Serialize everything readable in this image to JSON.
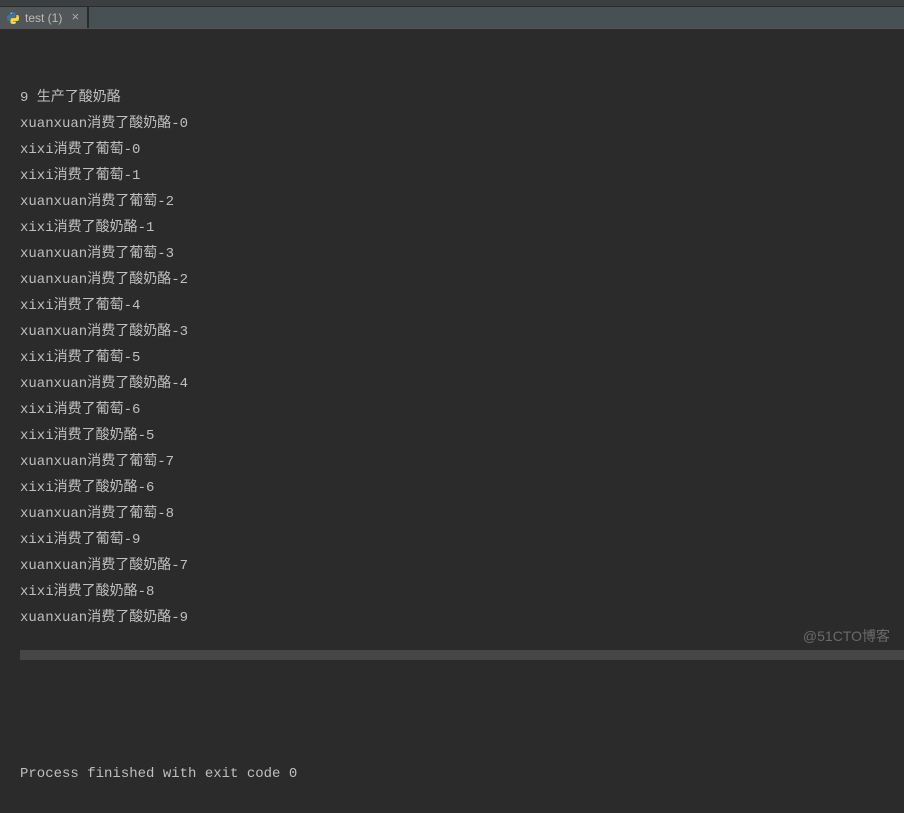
{
  "tab": {
    "label": "test (1)",
    "icon_name": "python-file-icon"
  },
  "console": {
    "lines": [
      "9 生产了酸奶酪",
      "xuanxuan消费了酸奶酪-0",
      "xixi消费了葡萄-0",
      "xixi消费了葡萄-1",
      "xuanxuan消费了葡萄-2",
      "xixi消费了酸奶酪-1",
      "xuanxuan消费了葡萄-3",
      "xuanxuan消费了酸奶酪-2",
      "xixi消费了葡萄-4",
      "xuanxuan消费了酸奶酪-3",
      "xixi消费了葡萄-5",
      "xuanxuan消费了酸奶酪-4",
      "xixi消费了葡萄-6",
      "xixi消费了酸奶酪-5",
      "xuanxuan消费了葡萄-7",
      "xixi消费了酸奶酪-6",
      "xuanxuan消费了葡萄-8",
      "xixi消费了葡萄-9",
      "xuanxuan消费了酸奶酪-7",
      "xixi消费了酸奶酪-8",
      "xuanxuan消费了酸奶酪-9"
    ],
    "exit_message": "Process finished with exit code 0"
  },
  "watermark": "@51CTO博客"
}
